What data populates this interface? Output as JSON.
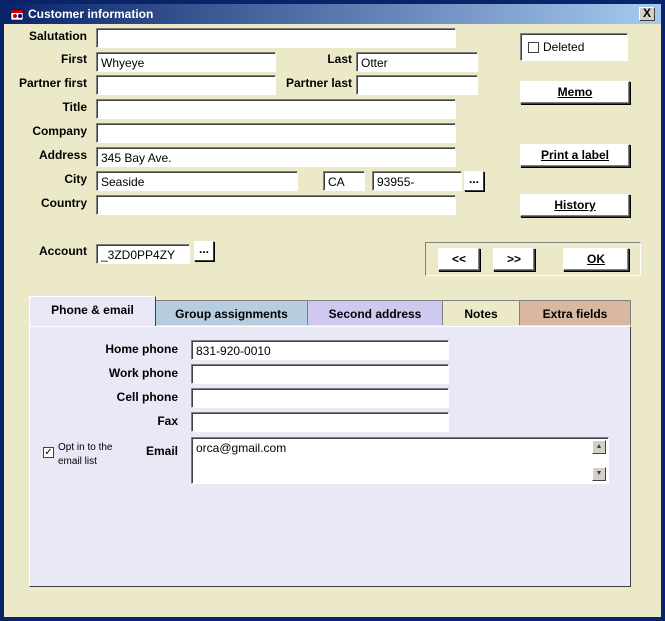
{
  "window": {
    "title": "Customer information",
    "close_label": "X"
  },
  "form": {
    "salutation": {
      "label": "Salutation",
      "value": ""
    },
    "first": {
      "label": "First",
      "value": "Whyeye"
    },
    "last": {
      "label": "Last",
      "value": "Otter"
    },
    "partner_first": {
      "label": "Partner first",
      "value": ""
    },
    "partner_last": {
      "label": "Partner last",
      "value": ""
    },
    "title": {
      "label": "Title",
      "value": ""
    },
    "company": {
      "label": "Company",
      "value": ""
    },
    "address": {
      "label": "Address",
      "value": "345 Bay Ave."
    },
    "city": {
      "label": "City",
      "value": "Seaside"
    },
    "state": {
      "value": "CA"
    },
    "zip": {
      "value": "93955-"
    },
    "country": {
      "label": "Country",
      "value": ""
    },
    "account": {
      "label": "Account",
      "value": "_3ZD0PP4ZY"
    },
    "dots_label": "..."
  },
  "side": {
    "deleted_label": "Deleted",
    "memo_label": "Memo",
    "print_label": "Print a label",
    "history_label": "History"
  },
  "nav": {
    "prev_label": "<<",
    "next_label": ">>",
    "ok_label": "OK"
  },
  "tabs": [
    {
      "label": "Phone & email",
      "active": true,
      "color": "#e8e8f6"
    },
    {
      "label": "Group assignments",
      "active": false,
      "color": "#b6cde0"
    },
    {
      "label": "Second address",
      "active": false,
      "color": "#cfc8f0"
    },
    {
      "label": "Notes",
      "active": false,
      "color": "#ece9c9"
    },
    {
      "label": "Extra fields",
      "active": false,
      "color": "#d8b8a0"
    }
  ],
  "phone_tab": {
    "home_phone": {
      "label": "Home phone",
      "value": "831-920-0010"
    },
    "work_phone": {
      "label": "Work phone",
      "value": ""
    },
    "cell_phone": {
      "label": "Cell phone",
      "value": ""
    },
    "fax": {
      "label": "Fax",
      "value": ""
    },
    "email": {
      "label": "Email",
      "value": "orca@gmail.com"
    },
    "opt_in": {
      "line1": "Opt in to the",
      "line2": "email list",
      "checked": true
    }
  }
}
